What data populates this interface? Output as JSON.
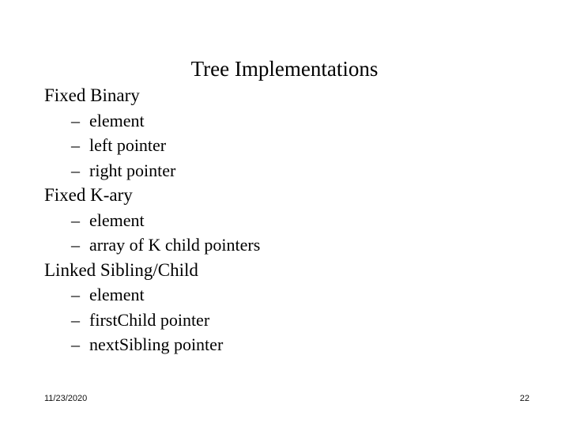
{
  "slide": {
    "title": "Tree Implementations",
    "background_color": "#ffffff",
    "text_color": "#000000",
    "bullet_glyph": "–",
    "outline": [
      {
        "level": 1,
        "text": "Fixed Binary"
      },
      {
        "level": 2,
        "text": "element"
      },
      {
        "level": 2,
        "text": "left pointer"
      },
      {
        "level": 2,
        "text": "right pointer"
      },
      {
        "level": 1,
        "text": "Fixed K-ary"
      },
      {
        "level": 2,
        "text": "element"
      },
      {
        "level": 2,
        "text": "array of K child pointers"
      },
      {
        "level": 1,
        "text": "Linked Sibling/Child"
      },
      {
        "level": 2,
        "text": "element"
      },
      {
        "level": 2,
        "text": "firstChild pointer"
      },
      {
        "level": 2,
        "text": "nextSibling pointer"
      }
    ],
    "footer": {
      "date": "11/23/2020",
      "page_number": "22"
    }
  }
}
